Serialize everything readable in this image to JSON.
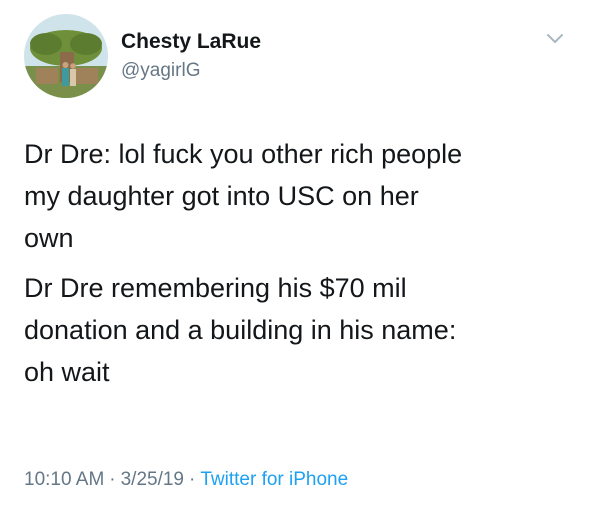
{
  "author": {
    "display_name": "Chesty LaRue",
    "handle": "@yagirlG"
  },
  "tweet": {
    "paragraphs": [
      "Dr Dre: lol fuck you other rich people\nmy daughter got into USC on her\nown",
      "Dr Dre remembering his $70 mil\ndonation and a building in his name:\noh wait"
    ],
    "time": "10:10 AM",
    "date": "3/25/19",
    "separator": "·",
    "source": "Twitter for iPhone"
  },
  "icons": {
    "menu": "chevron-down-icon"
  },
  "colors": {
    "text": "#14171a",
    "secondary": "#657786",
    "link": "#1da1f2"
  }
}
